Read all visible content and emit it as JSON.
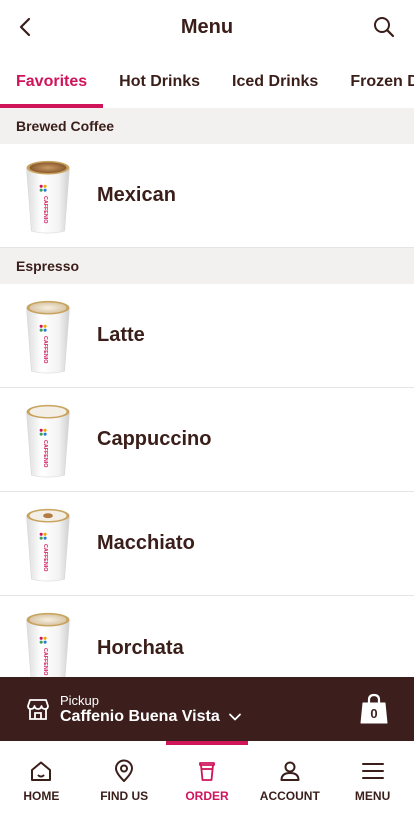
{
  "header": {
    "title": "Menu"
  },
  "tabs": [
    {
      "label": "Favorites",
      "active": true
    },
    {
      "label": "Hot Drinks",
      "active": false
    },
    {
      "label": "Iced Drinks",
      "active": false
    },
    {
      "label": "Frozen Drinks",
      "active": false
    }
  ],
  "sections": [
    {
      "title": "Brewed Coffee",
      "items": [
        {
          "name": "Mexican"
        }
      ]
    },
    {
      "title": "Espresso",
      "items": [
        {
          "name": "Latte"
        },
        {
          "name": "Cappuccino"
        },
        {
          "name": "Macchiato"
        },
        {
          "name": "Horchata"
        }
      ]
    }
  ],
  "cup_brand": "CAFFENIO",
  "pickup": {
    "label": "Pickup",
    "store": "Caffenio Buena Vista",
    "bag_count": "0"
  },
  "nav": [
    {
      "label": "HOME",
      "icon": "home-icon",
      "active": false
    },
    {
      "label": "FIND US",
      "icon": "location-pin-icon",
      "active": false
    },
    {
      "label": "ORDER",
      "icon": "cup-icon",
      "active": true
    },
    {
      "label": "ACCOUNT",
      "icon": "person-icon",
      "active": false
    },
    {
      "label": "MENU",
      "icon": "hamburger-menu-icon",
      "active": false
    }
  ],
  "colors": {
    "accent": "#d0145a",
    "brown": "#3c1f1d",
    "text": "#3a1e1a",
    "section_bg": "#f2f1ef"
  }
}
